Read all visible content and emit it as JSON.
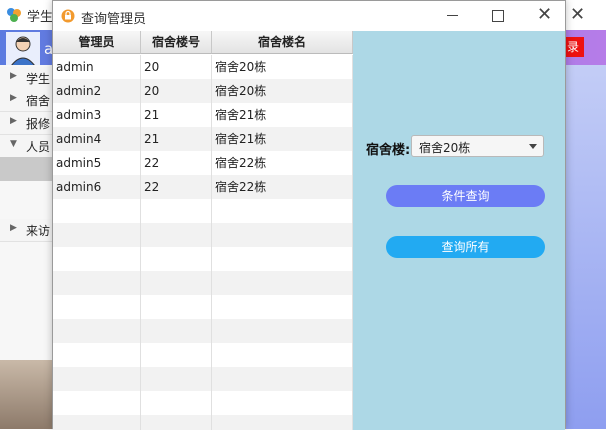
{
  "background_window": {
    "title": "学生",
    "user_initial": "a",
    "logout_label": "录",
    "nav_items": [
      {
        "label": "学生"
      },
      {
        "label": "宿舍"
      },
      {
        "label": "报修"
      },
      {
        "label": "人员"
      },
      {
        "label": "来访"
      }
    ]
  },
  "dialog": {
    "title": "查询管理员",
    "table": {
      "headers": [
        "管理员",
        "宿舍楼号",
        "宿舍楼名"
      ],
      "rows": [
        [
          "admin",
          "20",
          "宿舍20栋"
        ],
        [
          "admin2",
          "20",
          "宿舍20栋"
        ],
        [
          "admin3",
          "21",
          "宿舍21栋"
        ],
        [
          "admin4",
          "21",
          "宿舍21栋"
        ],
        [
          "admin5",
          "22",
          "宿舍22栋"
        ],
        [
          "admin6",
          "22",
          "宿舍22栋"
        ]
      ]
    },
    "filter": {
      "label": "宿舍楼:",
      "selected": "宿舍20栋"
    },
    "buttons": {
      "condition_query": "条件查询",
      "query_all": "查询所有"
    }
  },
  "colors": {
    "panel_bg": "#add8e6",
    "condition_button": "#6b7cf5",
    "query_all_button": "#22aaf2",
    "logout_button": "#ee1111"
  }
}
